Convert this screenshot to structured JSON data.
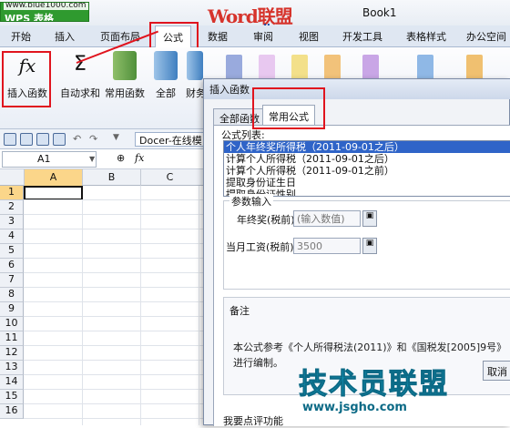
{
  "titlebar": {
    "app_button": "WPS 表格",
    "app_url": "www.blue1000.com",
    "logo_text": "Word联盟",
    "logo_url": "www.wordlm.com",
    "doc_title": "Book1"
  },
  "tabs": [
    "开始",
    "插入",
    "页面布局",
    "公式",
    "数据",
    "审阅",
    "视图",
    "开发工具",
    "表格样式",
    "办公空间"
  ],
  "active_tab": "公式",
  "ribbon": {
    "insert_function": "插入函数",
    "autosum": "自动求和",
    "common_functions": "常用函数",
    "all": "全部",
    "finance": "财务",
    "fx_glyph": "fx",
    "sigma_glyph": "Σ"
  },
  "quick_access": {
    "docer": "Docer-在线模"
  },
  "formula_bar": {
    "cell_ref": "A1",
    "zoom_icon_glyph": "⊕",
    "fx_glyph": "fx"
  },
  "sheet": {
    "columns": [
      "A",
      "B",
      "C"
    ],
    "rows": [
      "1",
      "2",
      "3",
      "4",
      "5",
      "6",
      "7",
      "8",
      "9",
      "10",
      "11",
      "12",
      "13",
      "14",
      "15",
      "16"
    ]
  },
  "dialog": {
    "title": "插入函数",
    "tabs": [
      "全部函数",
      "常用公式"
    ],
    "active_tab": "常用公式",
    "list_label": "公式列表:",
    "formulas": [
      "个人年终奖所得税（2011-09-01之后）",
      "计算个人所得税（2011-09-01之后）",
      "计算个人所得税（2011-09-01之前）",
      "提取身份证生日",
      "提取身份证性别"
    ],
    "selected_formula": 0,
    "params_label": "参数输入",
    "param1_label": "年终奖(税前)",
    "param1_placeholder": "(输入数值)",
    "param2_label": "当月工资(税前)",
    "param2_value": "3500",
    "notes_title": "备注",
    "notes_body": "本公式参考《个人所得税法(2011)》和《国税发[2005]9号》进行编制。",
    "feedback_link": "我要点评功能",
    "cancel_label": "取消"
  },
  "watermark": {
    "text": "技术员联盟",
    "url": "www.jsgho.com"
  },
  "colors": {
    "highlight": "#e0141e",
    "selection": "#2f64c8",
    "wps_green": "#2f9a2f"
  }
}
